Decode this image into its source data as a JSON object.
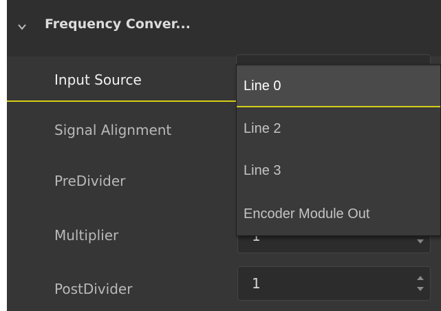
{
  "group": {
    "title": "Frequency Conver...",
    "expand_icon": "chevron-down-icon"
  },
  "properties": [
    {
      "label": "Input Source",
      "selected": true
    },
    {
      "label": "Signal Alignment"
    },
    {
      "label": "PreDivider"
    },
    {
      "label": "Multiplier",
      "value": "1"
    },
    {
      "label": "PostDivider",
      "value": "1"
    }
  ],
  "dropdown": {
    "selected": "Line 0",
    "options": [
      "Line 0",
      "Line 2",
      "Line 3",
      "Encoder Module Out"
    ]
  },
  "colors": {
    "accent": "#d6cf18",
    "panel_bg": "#363636",
    "header_bg": "#2f2f2f"
  }
}
